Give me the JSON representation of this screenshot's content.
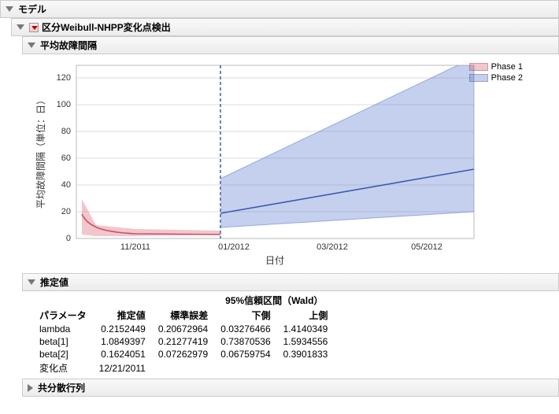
{
  "headers": {
    "model": "モデル",
    "weibull": "区分Weibull-NHPP変化点検出",
    "mtbf": "平均故障間隔",
    "estimates": "推定値",
    "covariance": "共分散行列"
  },
  "legend": {
    "phase1": "Phase 1",
    "phase2": "Phase 2"
  },
  "axes": {
    "x_label": "日付",
    "y_label": "平均故障間隔（単位：日）",
    "x_ticks": [
      "11/2011",
      "01/2012",
      "03/2012",
      "05/2012"
    ],
    "y_ticks": [
      "0",
      "20",
      "40",
      "60",
      "80",
      "100",
      "120"
    ]
  },
  "table": {
    "cols": {
      "param": "パラメータ",
      "estimate": "推定値",
      "stderr": "標準誤差",
      "ci_group": "95%信頼区間（Wald）",
      "lower": "下側",
      "upper": "上側"
    },
    "rows": [
      {
        "param": "lambda",
        "estimate": "0.2152449",
        "stderr": "0.20672964",
        "lower": "0.03276466",
        "upper": "1.4140349"
      },
      {
        "param": "beta[1]",
        "estimate": "1.0849397",
        "stderr": "0.21277419",
        "lower": "0.73870536",
        "upper": "1.5934556"
      },
      {
        "param": "beta[2]",
        "estimate": "0.1624051",
        "stderr": "0.07262979",
        "lower": "0.06759754",
        "upper": "0.3901833"
      }
    ],
    "changepoint_label": "変化点",
    "changepoint_value": "12/21/2011"
  },
  "chart_data": {
    "type": "line",
    "title": "平均故障間隔",
    "xlabel": "日付",
    "ylabel": "平均故障間隔（単位：日）",
    "ylim": [
      0,
      130
    ],
    "x_range": [
      "2011-10-01",
      "2012-06-20"
    ],
    "changepoint": "2011-12-21",
    "series": [
      {
        "name": "Phase 1 mean",
        "color": "#c94f62",
        "x": [
          "2011-10-05",
          "2011-10-10",
          "2011-10-20",
          "2011-11-01",
          "2011-11-15",
          "2011-12-01",
          "2011-12-21"
        ],
        "y": [
          18,
          8,
          5,
          4,
          3.5,
          3,
          3
        ]
      },
      {
        "name": "Phase 1 CI",
        "type": "area",
        "color": "rgba(222,90,108,.35)",
        "x": [
          "2011-10-05",
          "2011-10-20",
          "2011-11-15",
          "2011-12-21"
        ],
        "y_lower": [
          3,
          2,
          1.5,
          1.5
        ],
        "y_upper": [
          30,
          10,
          7,
          6
        ]
      },
      {
        "name": "Phase 2 mean",
        "color": "#3a5bb0",
        "x": [
          "2011-12-21",
          "2012-02-01",
          "2012-03-15",
          "2012-05-01",
          "2012-06-20"
        ],
        "y": [
          19,
          27,
          35,
          43,
          52
        ]
      },
      {
        "name": "Phase 2 CI",
        "type": "area",
        "color": "rgba(90,120,210,.35)",
        "x": [
          "2011-12-21",
          "2012-02-01",
          "2012-03-15",
          "2012-05-01",
          "2012-06-20"
        ],
        "y_lower": [
          8,
          10,
          13,
          16,
          20
        ],
        "y_upper": [
          45,
          65,
          90,
          115,
          135
        ]
      }
    ]
  }
}
